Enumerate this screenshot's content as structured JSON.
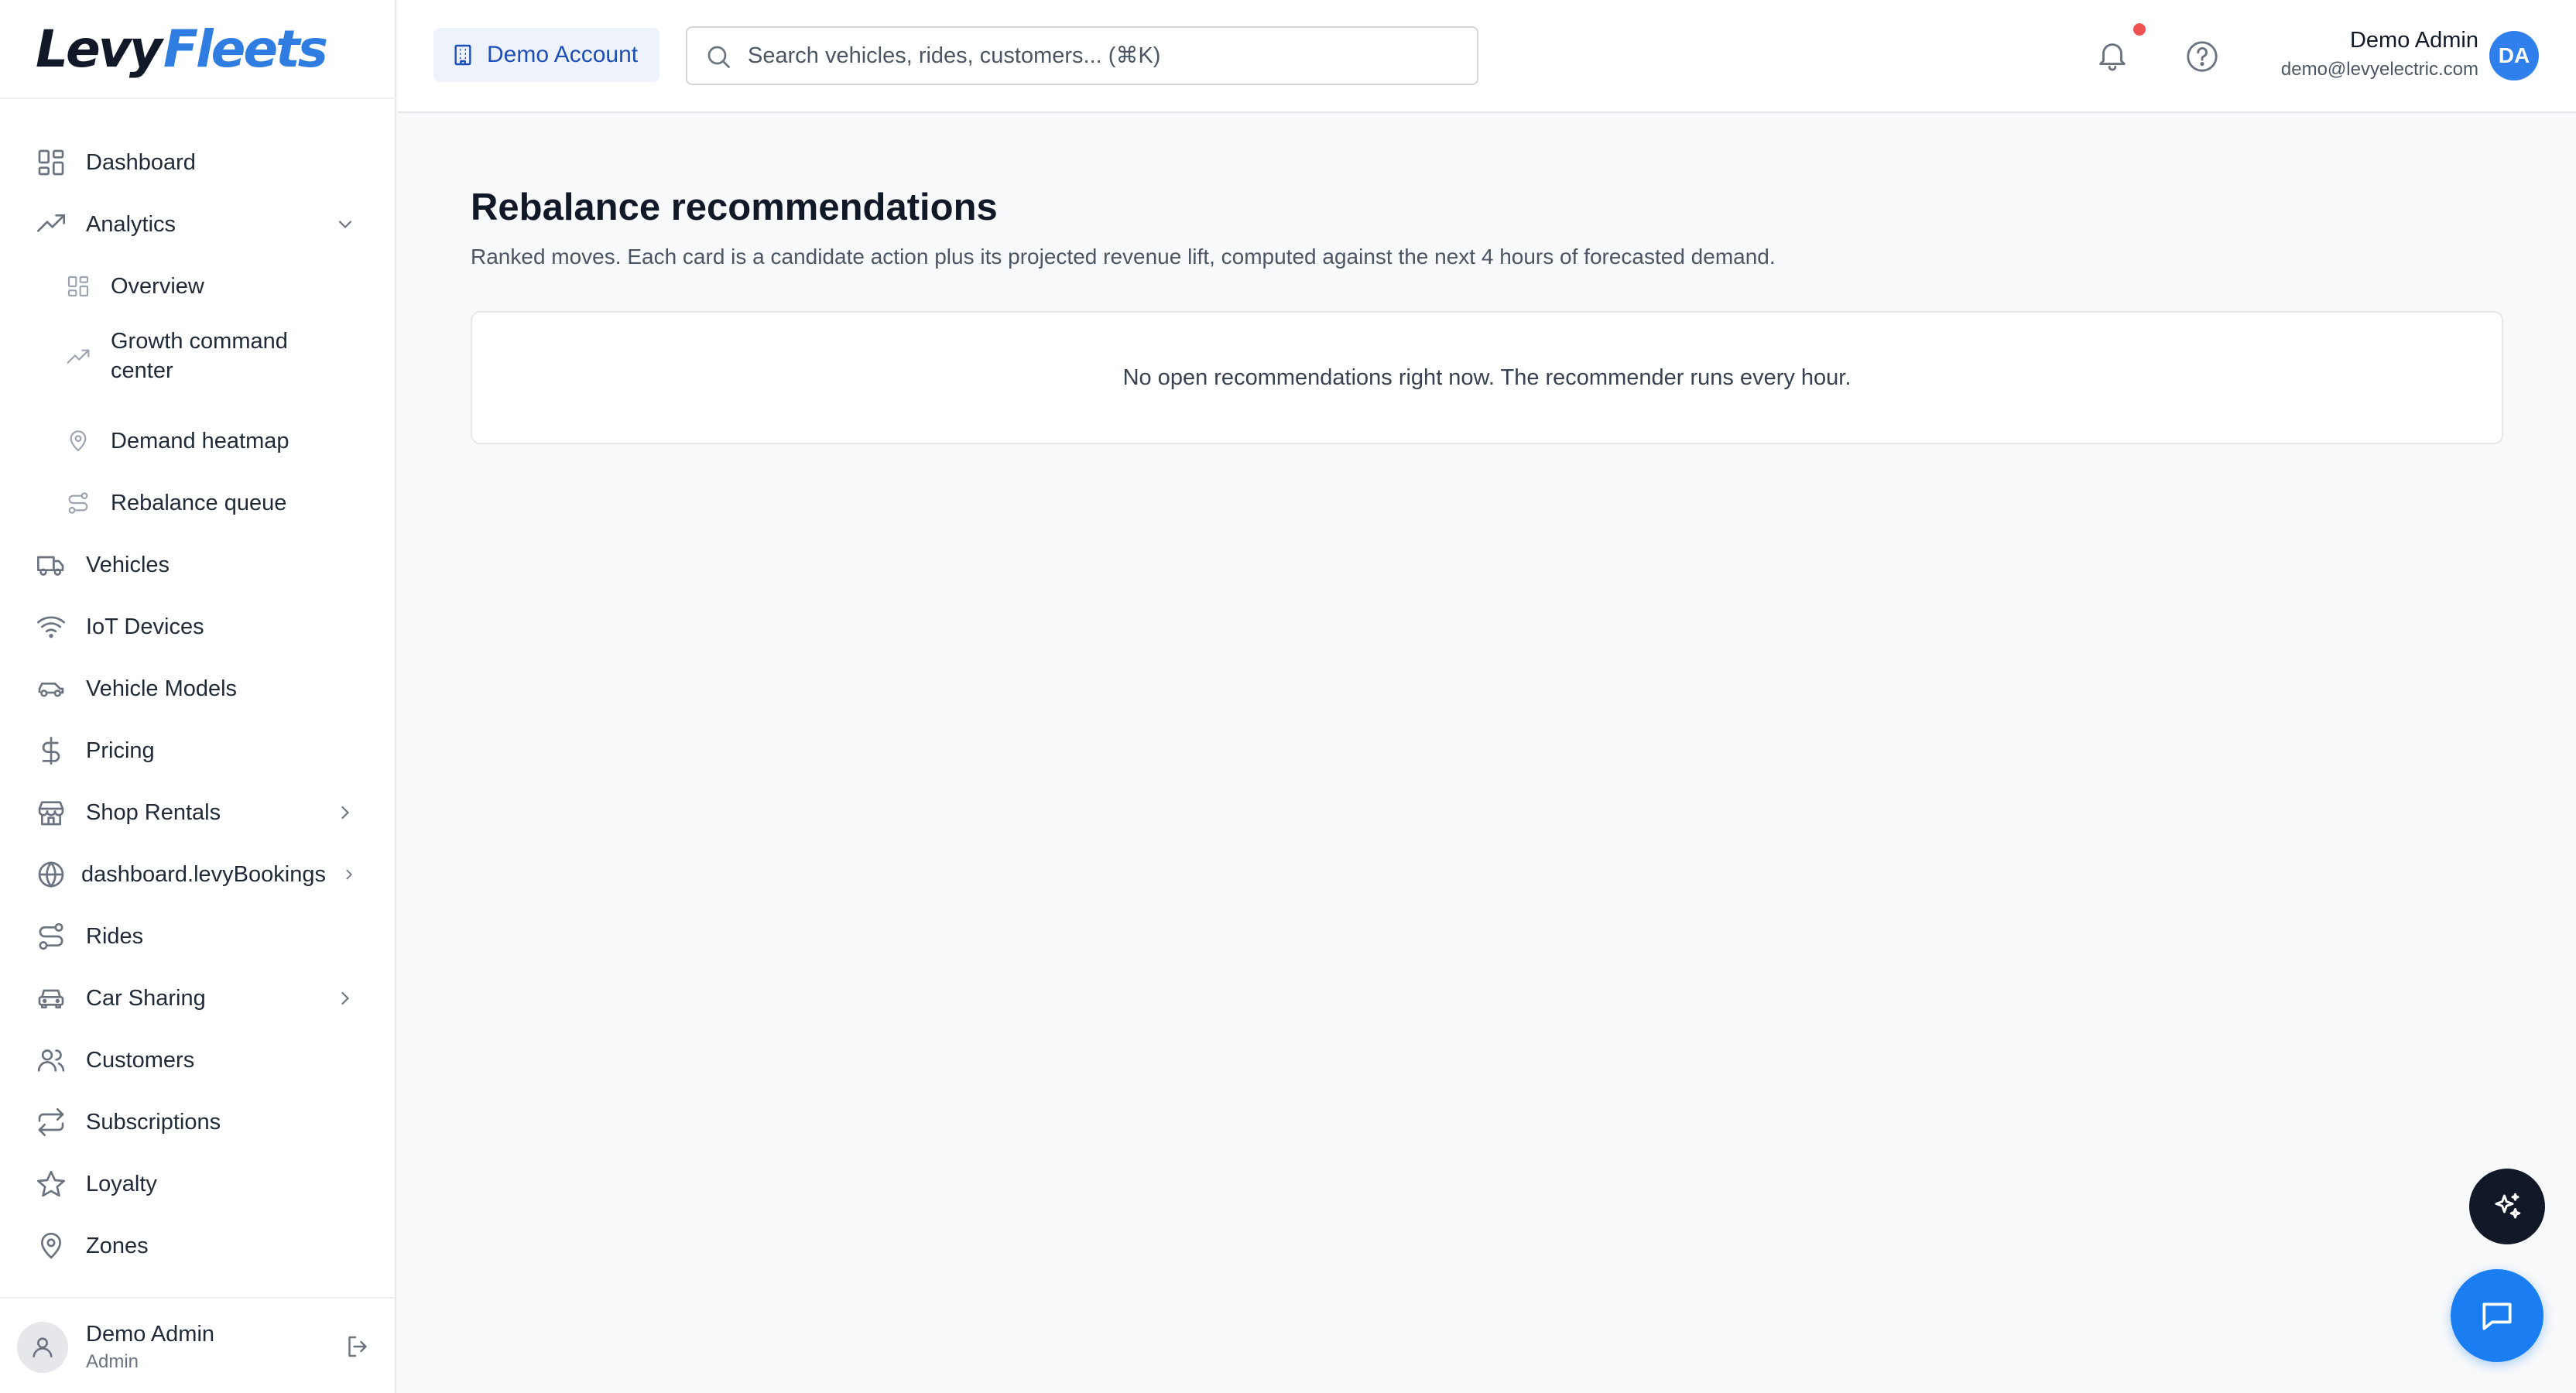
{
  "brand": {
    "logo_part1": "Levy",
    "logo_part2": "Fleets",
    "accent": "#2f7de0"
  },
  "sidebar": {
    "items": [
      {
        "label": "Dashboard",
        "icon": "dashboard-icon"
      },
      {
        "label": "Analytics",
        "icon": "trending-up-icon",
        "expanded": true
      },
      {
        "label": "Overview",
        "icon": "grid-icon",
        "sub": true
      },
      {
        "label": "Growth command center",
        "icon": "trending-up-icon",
        "sub": true
      },
      {
        "label": "Demand heatmap",
        "icon": "map-pin-icon",
        "sub": true
      },
      {
        "label": "Rebalance queue",
        "icon": "route-icon",
        "sub": true
      },
      {
        "label": "Vehicles",
        "icon": "truck-icon"
      },
      {
        "label": "IoT Devices",
        "icon": "wifi-icon"
      },
      {
        "label": "Vehicle Models",
        "icon": "car-icon"
      },
      {
        "label": "Pricing",
        "icon": "dollar-icon"
      },
      {
        "label": "Shop Rentals",
        "icon": "store-icon"
      },
      {
        "label": "dashboard.levyBookings",
        "icon": "globe-icon"
      },
      {
        "label": "Rides",
        "icon": "route-icon"
      },
      {
        "label": "Car Sharing",
        "icon": "car-front-icon"
      },
      {
        "label": "Customers",
        "icon": "users-icon"
      },
      {
        "label": "Subscriptions",
        "icon": "repeat-icon"
      },
      {
        "label": "Loyalty",
        "icon": "star-icon"
      },
      {
        "label": "Zones",
        "icon": "map-pin-icon"
      }
    ],
    "footer": {
      "name": "Demo Admin",
      "role": "Admin"
    }
  },
  "header": {
    "account_label": "Demo Account",
    "search_placeholder": "Search vehicles, rides, customers... (⌘K)",
    "user_name": "Demo Admin",
    "user_email": "demo@levyelectric.com",
    "user_initials": "DA"
  },
  "main": {
    "title": "Rebalance recommendations",
    "subtitle": "Ranked moves. Each card is a candidate action plus its projected revenue lift, computed against the next 4 hours of forecasted demand.",
    "empty_message": "No open recommendations right now. The recommender runs every hour."
  }
}
